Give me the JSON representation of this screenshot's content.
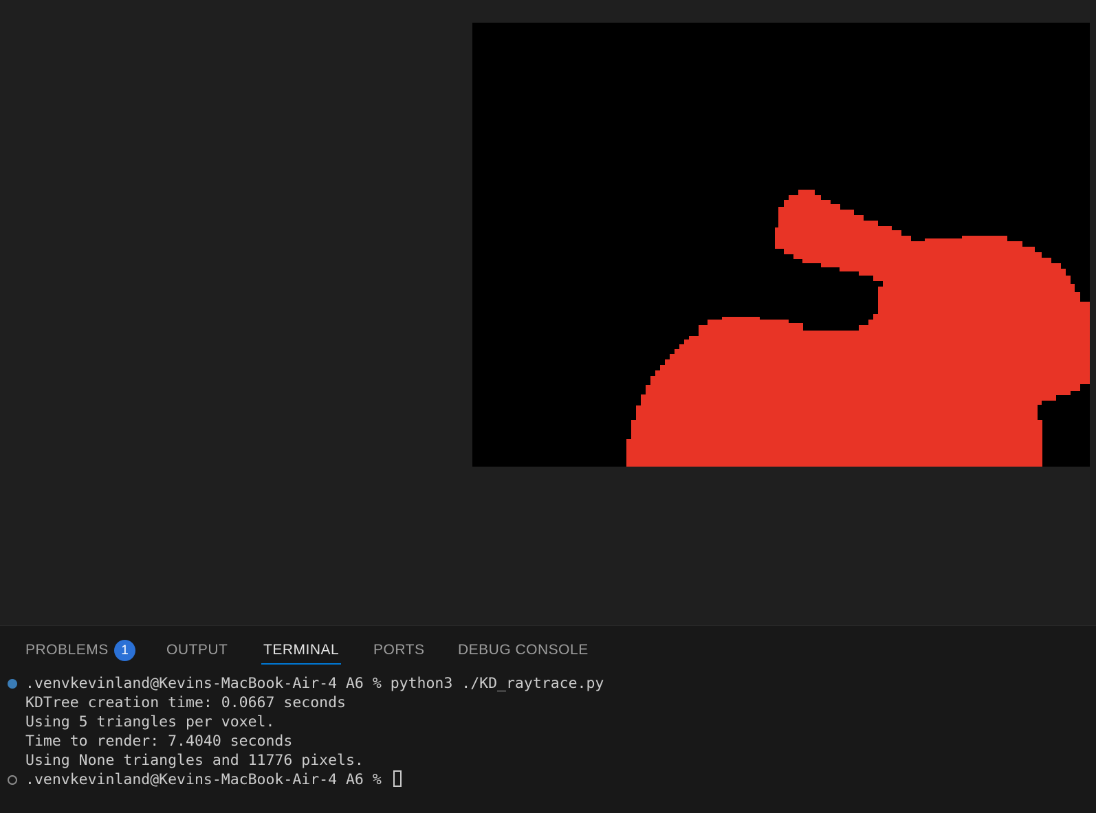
{
  "render_window": {
    "background_color": "#000000",
    "shape_color": "#e83426"
  },
  "panel": {
    "tabs": [
      {
        "label": "PROBLEMS",
        "badge": "1"
      },
      {
        "label": "OUTPUT"
      },
      {
        "label": "TERMINAL",
        "active": true
      },
      {
        "label": "PORTS"
      },
      {
        "label": "DEBUG CONSOLE"
      }
    ],
    "accent_color": "#0078d4"
  },
  "terminal": {
    "lines": [
      ".venvkevinland@Kevins-MacBook-Air-4 A6 % python3 ./KD_raytrace.py",
      "KDTree creation time: 0.0667 seconds",
      "Using 5 triangles per voxel.",
      "Time to render: 7.4040 seconds",
      "Using None triangles and 11776 pixels.",
      ".venvkevinland@Kevins-MacBook-Air-4 A6 % "
    ],
    "status_icons": [
      "filled-circle-icon",
      "hollow-circle-icon"
    ]
  }
}
